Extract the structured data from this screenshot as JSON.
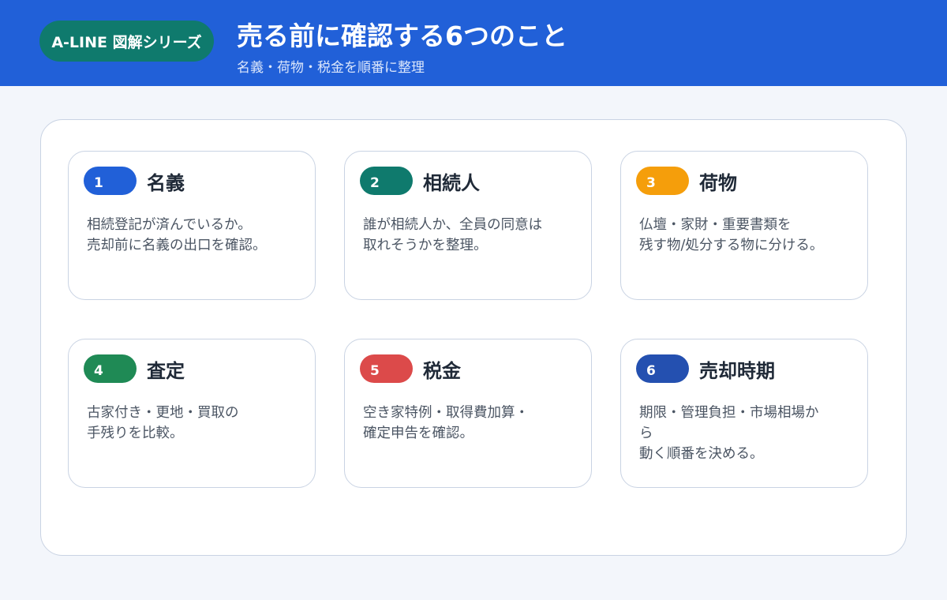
{
  "header": {
    "badge": "A-LINE 図解シリーズ",
    "title": "売る前に確認する6つのこと",
    "subtitle": "名義・荷物・税金を順番に整理"
  },
  "cards": [
    {
      "number": "1",
      "title": "名義",
      "color": "#2160d8",
      "lines": [
        "相続登記が済んでいるか。",
        "売却前に名義の出口を確認。"
      ]
    },
    {
      "number": "2",
      "title": "相続人",
      "color": "#0f7a6d",
      "lines": [
        "誰が相続人か、全員の同意は",
        "取れそうかを整理。"
      ]
    },
    {
      "number": "3",
      "title": "荷物",
      "color": "#f59e0b",
      "lines": [
        "仏壇・家財・重要書類を",
        "残す物/処分する物に分ける。"
      ]
    },
    {
      "number": "4",
      "title": "査定",
      "color": "#1f8a55",
      "lines": [
        "古家付き・更地・買取の",
        "手残りを比較。"
      ]
    },
    {
      "number": "5",
      "title": "税金",
      "color": "#dc4a4a",
      "lines": [
        "空き家特例・取得費加算・",
        "確定申告を確認。"
      ]
    },
    {
      "number": "6",
      "title": "売却時期",
      "color": "#2450b0",
      "lines": [
        "期限・管理負担・市場相場か",
        "ら",
        "動く順番を決める。"
      ]
    }
  ]
}
